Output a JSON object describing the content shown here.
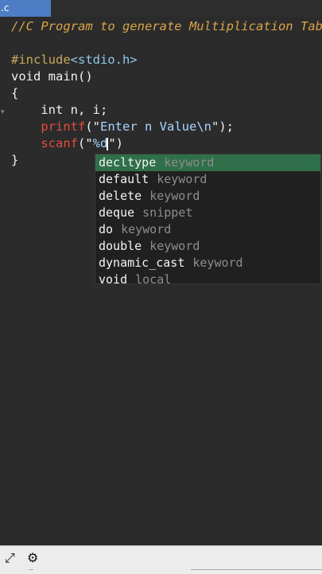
{
  "tab": {
    "label": ".c"
  },
  "code": {
    "line1": "//C Program to generate Multiplication Tabl",
    "include_kw": "#include",
    "include_hdr": "<stdio.h>",
    "main": "void main()",
    "open_brace": "{",
    "decl": "    int n, i;",
    "indent": "    ",
    "printf_fn": "printf",
    "printf_rest_open": "(\"",
    "printf_str": "Enter n Value\\n",
    "printf_rest_close": "\");",
    "scanf_fn": "scanf",
    "scanf_open": "(\"",
    "scanf_fmt": "%d",
    "scanf_close": "\")",
    "close_brace": "}"
  },
  "autocomplete": {
    "items": [
      {
        "label": "decltype",
        "kind": "keyword"
      },
      {
        "label": "default",
        "kind": "keyword"
      },
      {
        "label": "delete",
        "kind": "keyword"
      },
      {
        "label": "deque",
        "kind": "snippet"
      },
      {
        "label": "do",
        "kind": "keyword"
      },
      {
        "label": "double",
        "kind": "keyword"
      },
      {
        "label": "dynamic_cast",
        "kind": "keyword"
      },
      {
        "label": "void",
        "kind": "local"
      }
    ]
  },
  "icons": {
    "expand": "expand-icon",
    "settings": "gear-icon"
  },
  "colors": {
    "tab": "#4d7dc4",
    "selection": "#2f6f4a",
    "background": "#2b2b2b"
  }
}
